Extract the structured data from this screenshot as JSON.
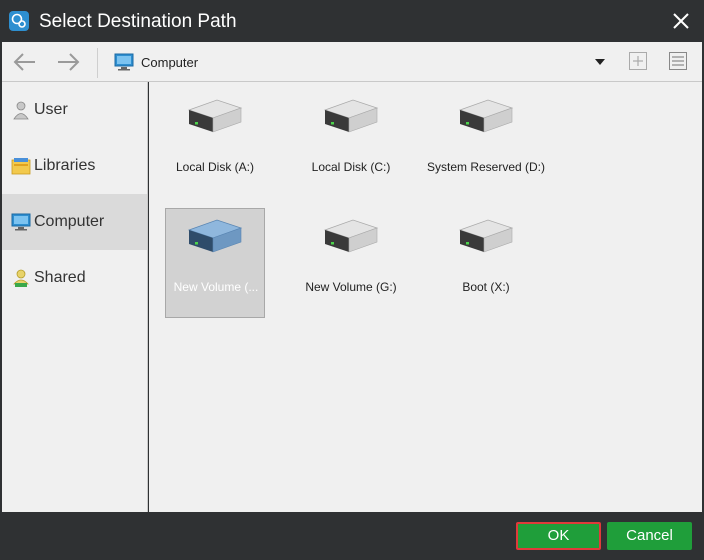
{
  "window": {
    "title": "Select Destination Path"
  },
  "toolbar": {
    "location": "Computer"
  },
  "sidebar": {
    "items": [
      {
        "label": "User",
        "icon": "user-icon"
      },
      {
        "label": "Libraries",
        "icon": "libraries-icon"
      },
      {
        "label": "Computer",
        "icon": "computer-icon",
        "selected": true
      },
      {
        "label": "Shared",
        "icon": "shared-icon"
      }
    ]
  },
  "drives": [
    {
      "label": "Local Disk (A:)"
    },
    {
      "label": "Local Disk (C:)"
    },
    {
      "label": "System Reserved (D:)"
    },
    {
      "label": "New Volume (...",
      "selected": true
    },
    {
      "label": "New Volume (G:)"
    },
    {
      "label": "Boot (X:)"
    }
  ],
  "footer": {
    "ok_label": "OK",
    "cancel_label": "Cancel"
  },
  "colors": {
    "accent_button": "#1f9e3a",
    "highlight_border": "#e03a3a",
    "titlebar": "#2f3133"
  }
}
